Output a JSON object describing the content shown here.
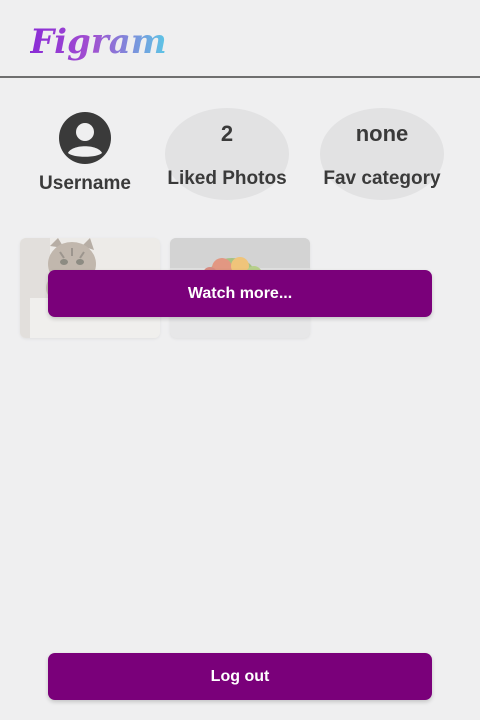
{
  "header": {
    "logo_text": "Figram"
  },
  "profile": {
    "username": "Username",
    "avatar_icon": "user-circle-icon"
  },
  "stats": {
    "liked_value": "2",
    "liked_label": "Liked Photos",
    "fav_value": "none",
    "fav_label": "Fav category"
  },
  "gallery": {
    "thumbnails": [
      {
        "subject": "cat photo"
      },
      {
        "subject": "fruit bowl photo"
      }
    ],
    "watch_more_label": "Watch more..."
  },
  "footer": {
    "logout_label": "Log out"
  },
  "colors": {
    "button_bg": "#7a007a",
    "page_bg": "#efeff0"
  }
}
